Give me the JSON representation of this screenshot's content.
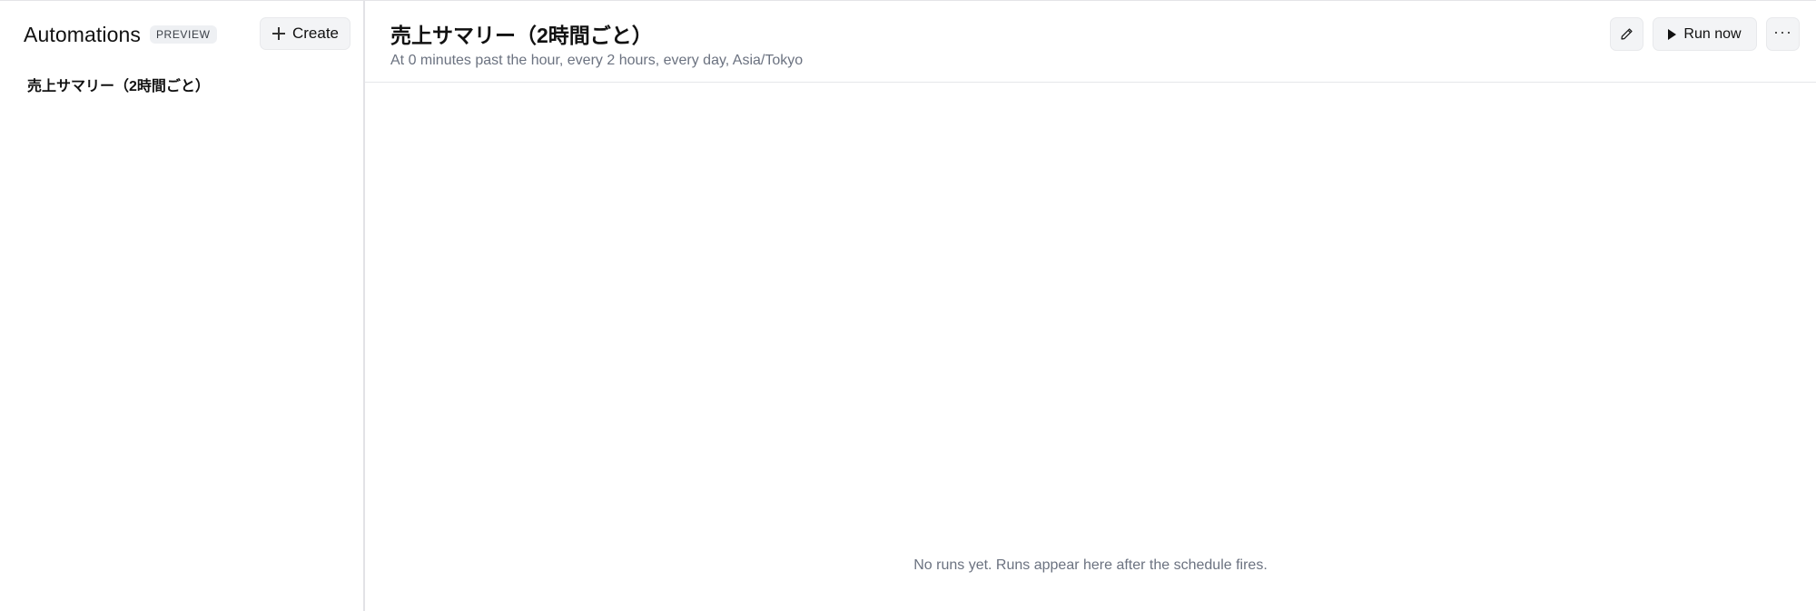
{
  "sidebar": {
    "title": "Automations",
    "badge": "PREVIEW",
    "create_label": "Create",
    "items": [
      {
        "label": "売上サマリー（2時間ごと）"
      }
    ]
  },
  "main": {
    "title": "売上サマリー（2時間ごと）",
    "schedule": "At 0 minutes past the hour, every 2 hours, every day, Asia/Tokyo",
    "toolbar": {
      "edit_icon": "pencil-icon",
      "run_label": "Run now",
      "more_label": "···"
    },
    "empty_message": "No runs yet. Runs appear here after the schedule fires."
  }
}
